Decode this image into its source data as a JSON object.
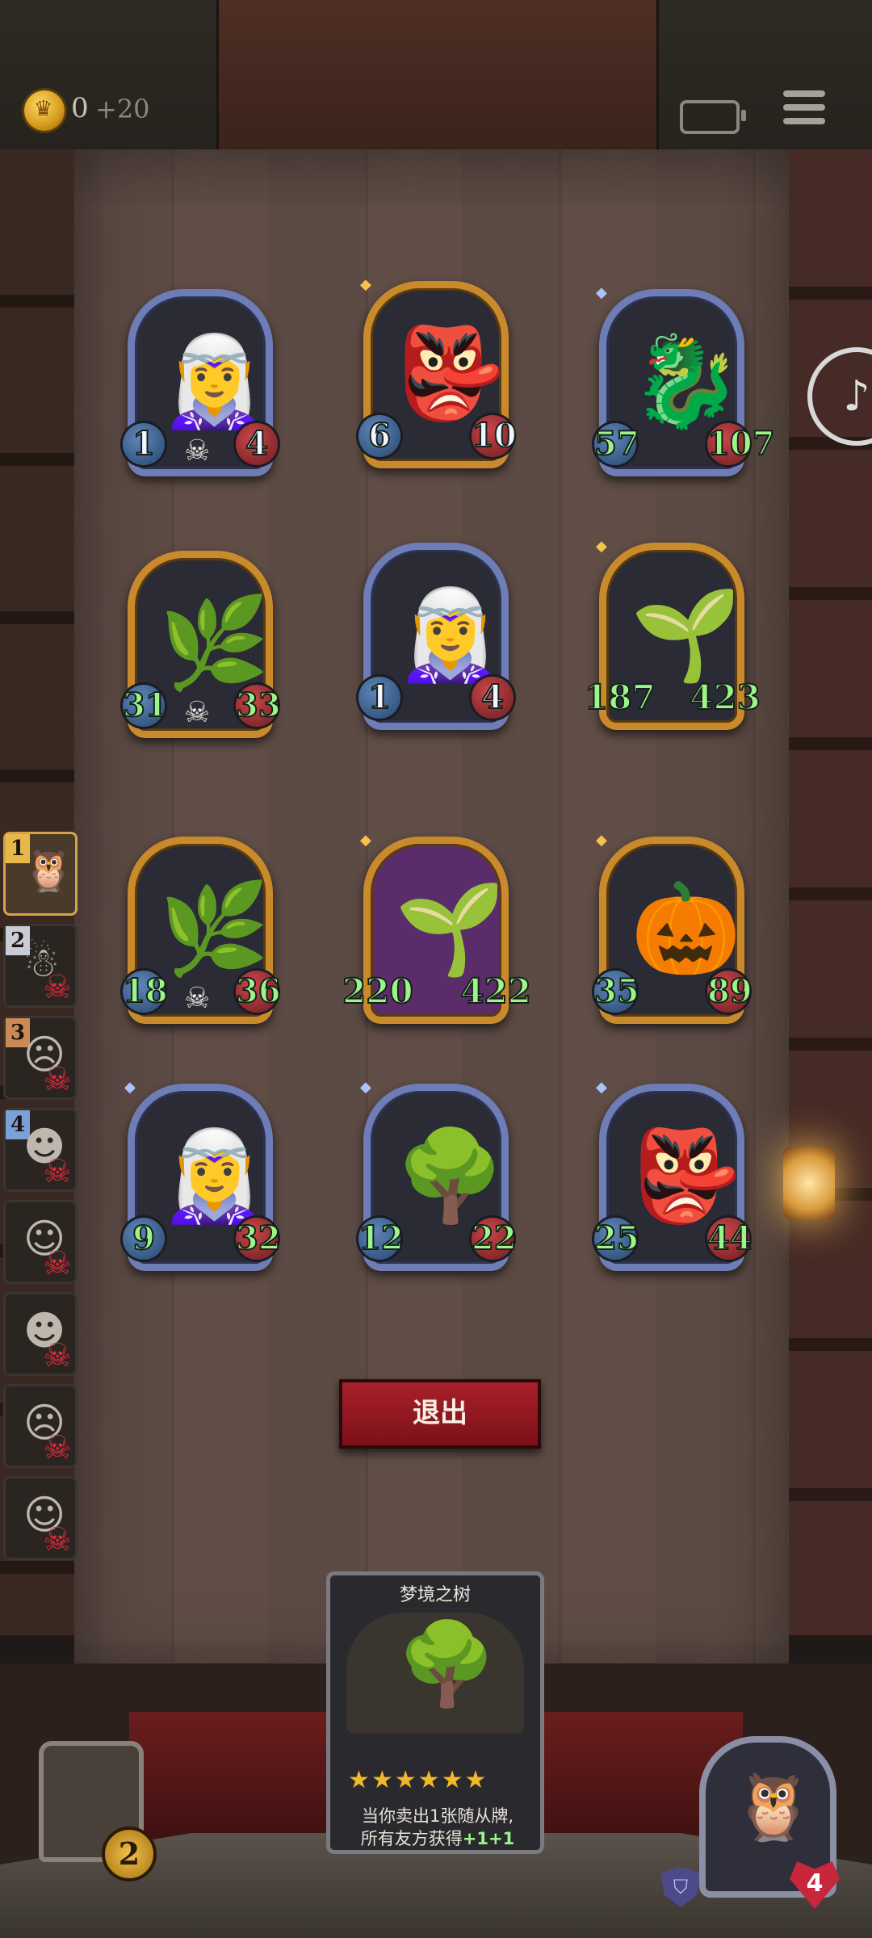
{
  "header": {
    "coins": "0",
    "coin_income": "+20",
    "icons": [
      "coin-icon",
      "battery-icon",
      "menu-icon"
    ]
  },
  "board": {
    "cards": [
      {
        "name": "elf-sorceress",
        "tier_frame": "blue",
        "attack": "1",
        "health": "4",
        "has_skull": true
      },
      {
        "name": "red-imp",
        "tier_frame": "gold",
        "attack": "6",
        "health": "10",
        "has_skull": false
      },
      {
        "name": "stone-gargoyle",
        "tier_frame": "blue",
        "attack": "57",
        "health": "107",
        "buffed": true
      },
      {
        "name": "vine-tree",
        "tier_frame": "gold",
        "attack": "31",
        "health": "33",
        "buffed": true,
        "has_skull": true
      },
      {
        "name": "elf-sorceress",
        "tier_frame": "blue",
        "attack": "1",
        "health": "4"
      },
      {
        "name": "leaf-girl",
        "tier_frame": "gold",
        "attack": "187",
        "health": "423",
        "buffed": true
      },
      {
        "name": "vine-tree",
        "tier_frame": "gold",
        "attack": "18",
        "health": "36",
        "buffed": true,
        "has_skull": true
      },
      {
        "name": "leaf-girl",
        "tier_frame": "gold",
        "attack": "220",
        "health": "422",
        "buffed": true
      },
      {
        "name": "pumpkin-ghost",
        "tier_frame": "gold",
        "attack": "35",
        "health": "89",
        "buffed": true
      },
      {
        "name": "elf-sorceress",
        "tier_frame": "blue",
        "attack": "9",
        "health": "32",
        "buffed": true
      },
      {
        "name": "dream-tree",
        "tier_frame": "blue",
        "attack": "12",
        "health": "22",
        "buffed": true
      },
      {
        "name": "red-imp",
        "tier_frame": "blue",
        "attack": "25",
        "health": "44",
        "buffed": true
      }
    ]
  },
  "opponents": [
    {
      "rank": "1",
      "eliminated": false,
      "active": true
    },
    {
      "rank": "2",
      "eliminated": true
    },
    {
      "rank": "3",
      "eliminated": true
    },
    {
      "rank": "4",
      "eliminated": true
    },
    {
      "rank": "",
      "eliminated": true
    },
    {
      "rank": "",
      "eliminated": true
    },
    {
      "rank": "",
      "eliminated": true
    },
    {
      "rank": "",
      "eliminated": true
    }
  ],
  "actions": {
    "exit_label": "退出"
  },
  "info_card": {
    "title": "梦境之树",
    "stars": "★★★★★★",
    "desc_line1": "当你卖出1张随从牌,",
    "desc_line2_prefix": "所有友方获得",
    "desc_line2_bonus": "+1+1"
  },
  "tavern": {
    "level": "2"
  },
  "hero": {
    "health": "4",
    "armor_icon": "shield-icon"
  },
  "colors": {
    "buff_green": "#9df58a",
    "attack_blue": "#26476e",
    "health_red": "#6d1c20",
    "exit_red": "#a8202a",
    "gold_frame": "#c98a2c",
    "blue_frame": "#6e7db5"
  }
}
